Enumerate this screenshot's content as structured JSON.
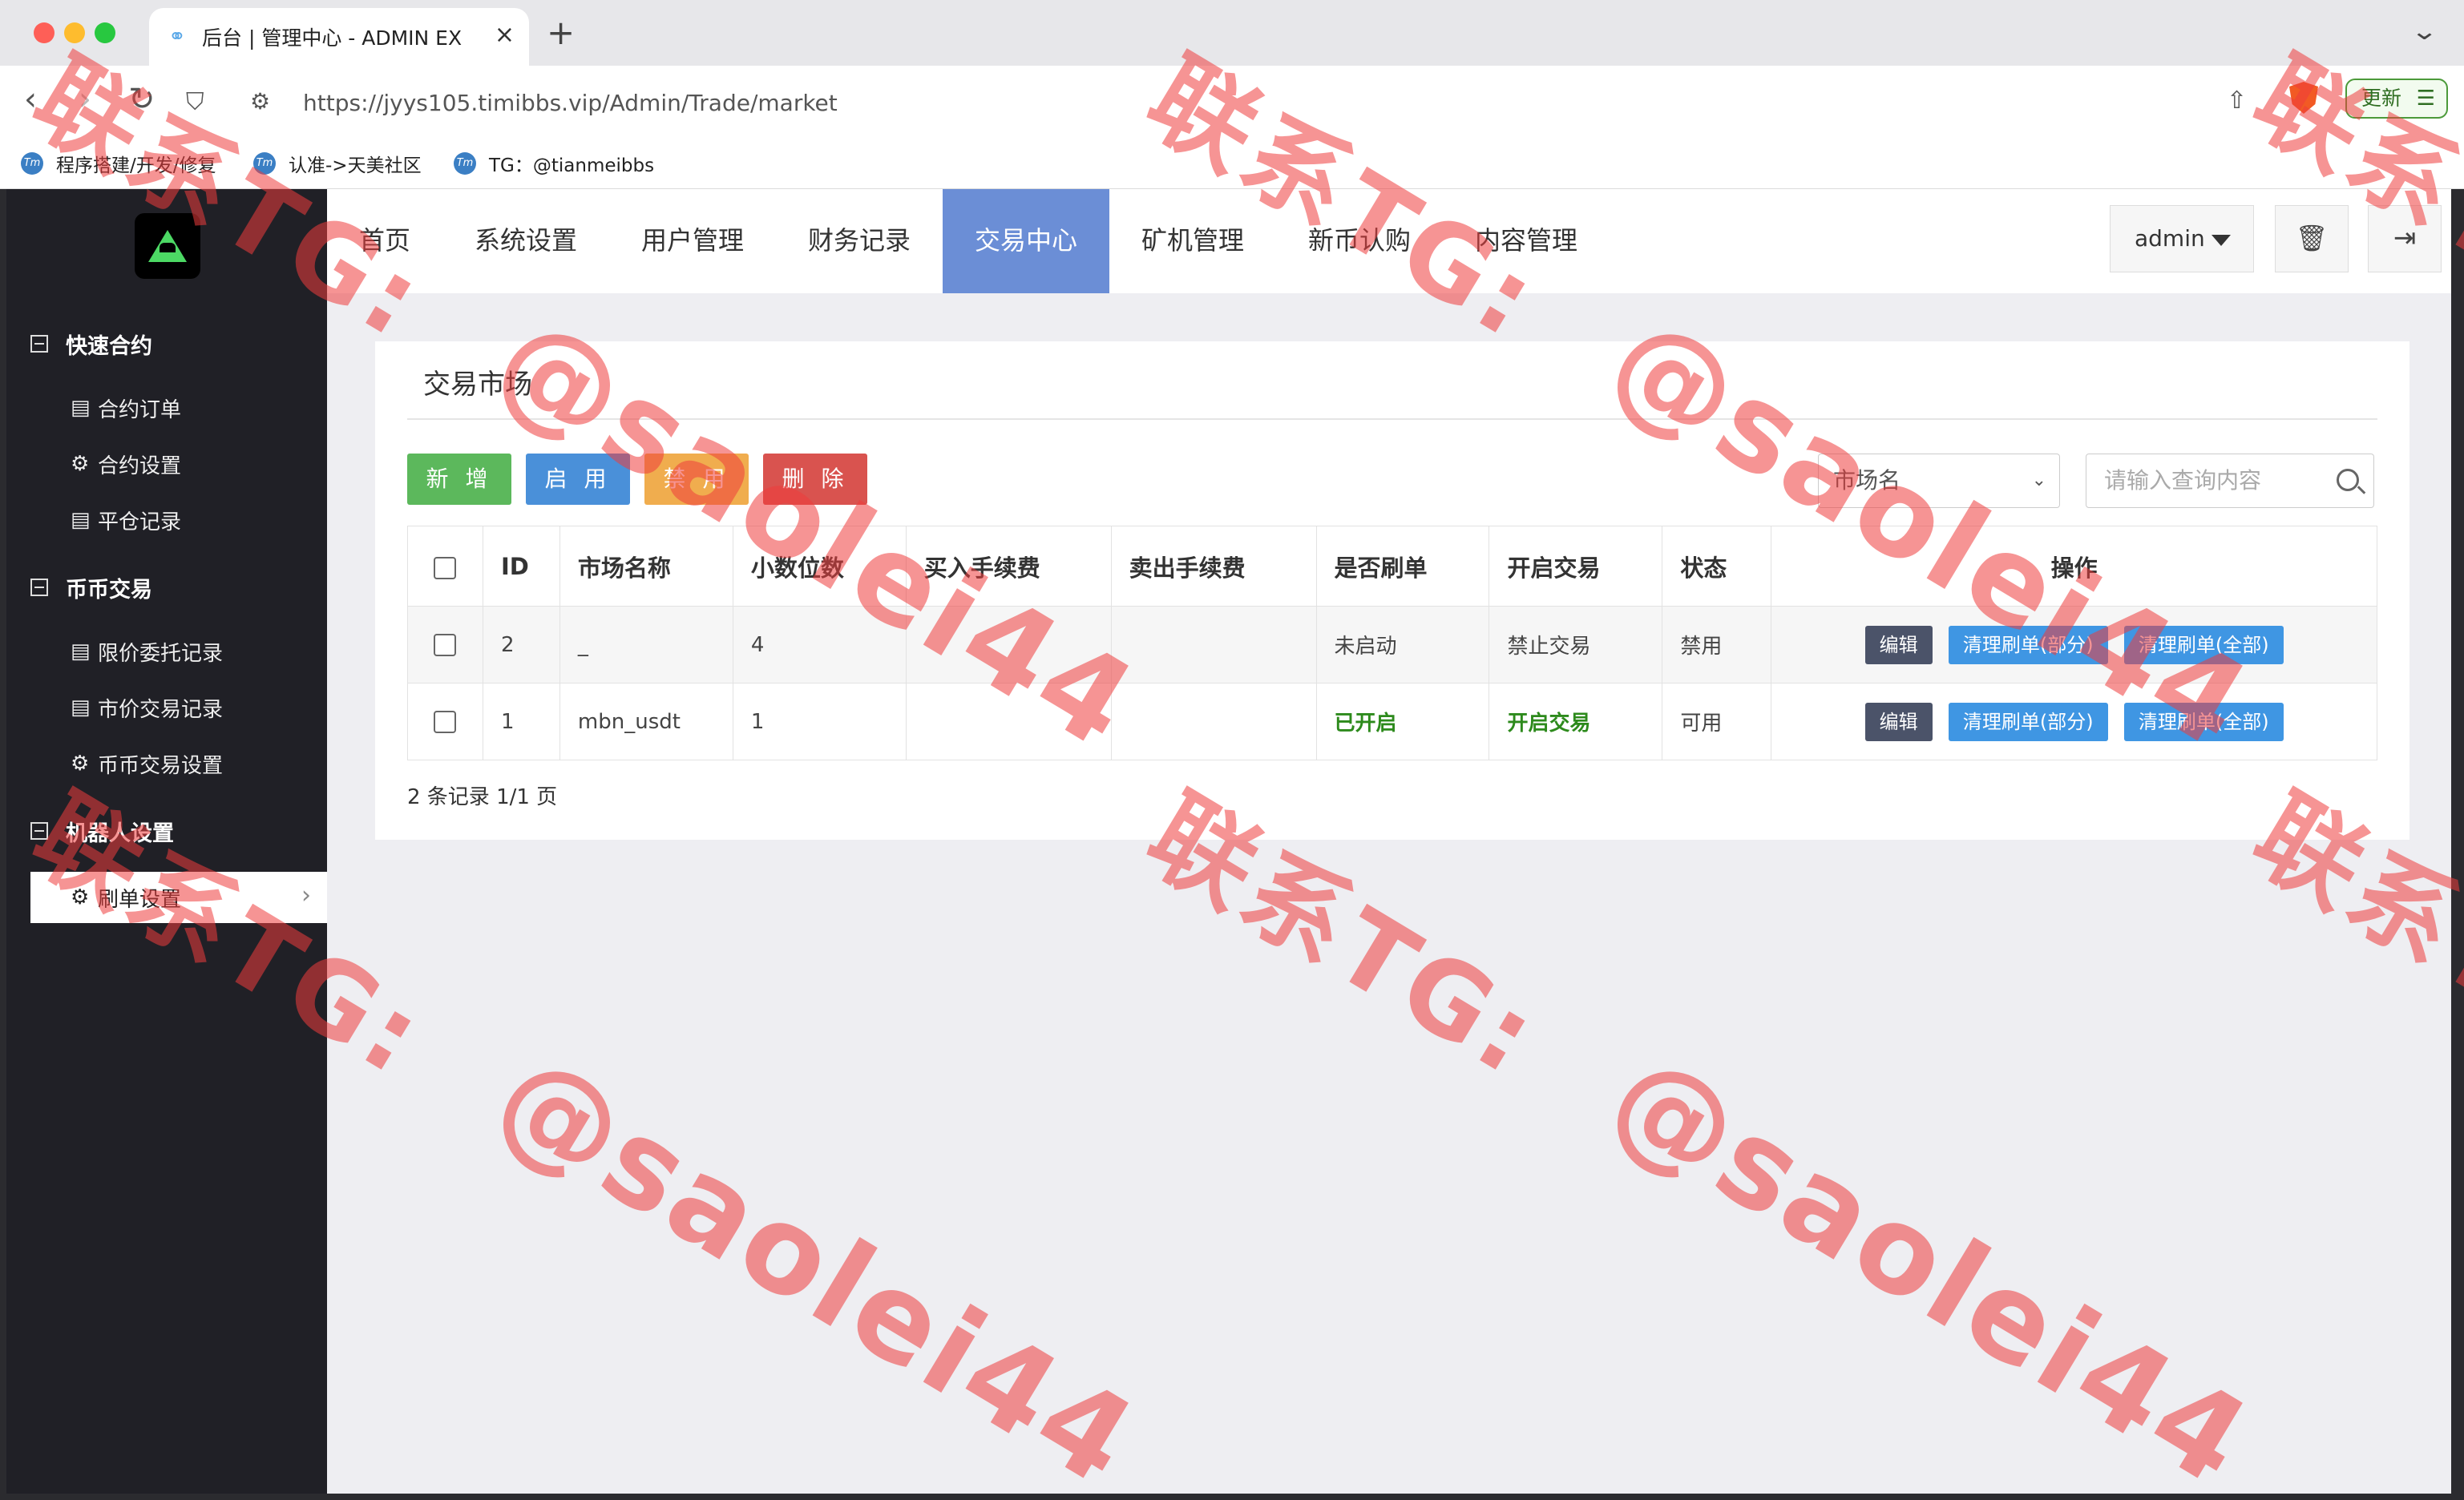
{
  "browser": {
    "tab_title": "后台 | 管理中心 - ADMIN EX",
    "tab_close": "×",
    "new_tab": "+",
    "url": "https://jyys105.timibbs.vip/Admin/Trade/market",
    "update_label": "更新",
    "bookmarks": [
      {
        "label": "程序搭建/开发/修复"
      },
      {
        "label": "认准->天美社区"
      },
      {
        "label": "TG：@tianmeibbs"
      }
    ]
  },
  "sidebar": {
    "groups": [
      {
        "label": "快速合约",
        "items": [
          {
            "icon": "list-icon",
            "label": "合约订单"
          },
          {
            "icon": "gear-icon",
            "label": "合约设置"
          },
          {
            "icon": "list-icon",
            "label": "平仓记录"
          }
        ]
      },
      {
        "label": "币币交易",
        "items": [
          {
            "icon": "list-icon",
            "label": "限价委托记录"
          },
          {
            "icon": "list-icon",
            "label": "市价交易记录"
          },
          {
            "icon": "gear-icon",
            "label": "币币交易设置"
          }
        ]
      },
      {
        "label": "机器人设置",
        "items": [
          {
            "icon": "gear-icon",
            "label": "刷单设置",
            "active": true
          }
        ]
      }
    ]
  },
  "topnav": {
    "items": [
      "首页",
      "系统设置",
      "用户管理",
      "财务记录",
      "交易中心",
      "矿机管理",
      "新币认购",
      "内容管理"
    ],
    "active": "交易中心",
    "admin_label": "admin"
  },
  "panel": {
    "title": "交易市场",
    "buttons": {
      "add": "新 增",
      "enable": "启 用",
      "disable": "禁 用",
      "delete": "删 除"
    },
    "select_value": "市场名",
    "search_placeholder": "请输入查询内容",
    "columns": [
      "ID",
      "市场名称",
      "小数位数",
      "买入手续费",
      "卖出手续费",
      "是否刷单",
      "开启交易",
      "状态",
      "操作"
    ],
    "rows": [
      {
        "id": "2",
        "name": "_",
        "decimals": "4",
        "buy_fee": "",
        "sell_fee": "",
        "brush": "未启动",
        "trade": "禁止交易",
        "status": "禁用",
        "brush_on": false
      },
      {
        "id": "1",
        "name": "mbn_usdt",
        "decimals": "1",
        "buy_fee": "",
        "sell_fee": "",
        "brush": "已开启",
        "trade": "开启交易",
        "status": "可用",
        "brush_on": true
      }
    ],
    "op_buttons": {
      "edit": "编辑",
      "clear_partial": "清理刷单(部分)",
      "clear_all": "清理刷单(全部)"
    },
    "pager": "2 条记录 1/1 页"
  },
  "watermark": {
    "line_a": "联系TG:",
    "line_b": "@saolei44"
  },
  "colors": {
    "active_nav": "#6b8ed6",
    "sidebar_bg": "#202026",
    "btn_add": "#5cb85c",
    "btn_enable": "#4a90d9",
    "btn_disable": "#f0ad4e",
    "btn_delete": "#d9534f",
    "enabled_text": "#2d8a1c",
    "watermark": "#ee3c3c"
  }
}
